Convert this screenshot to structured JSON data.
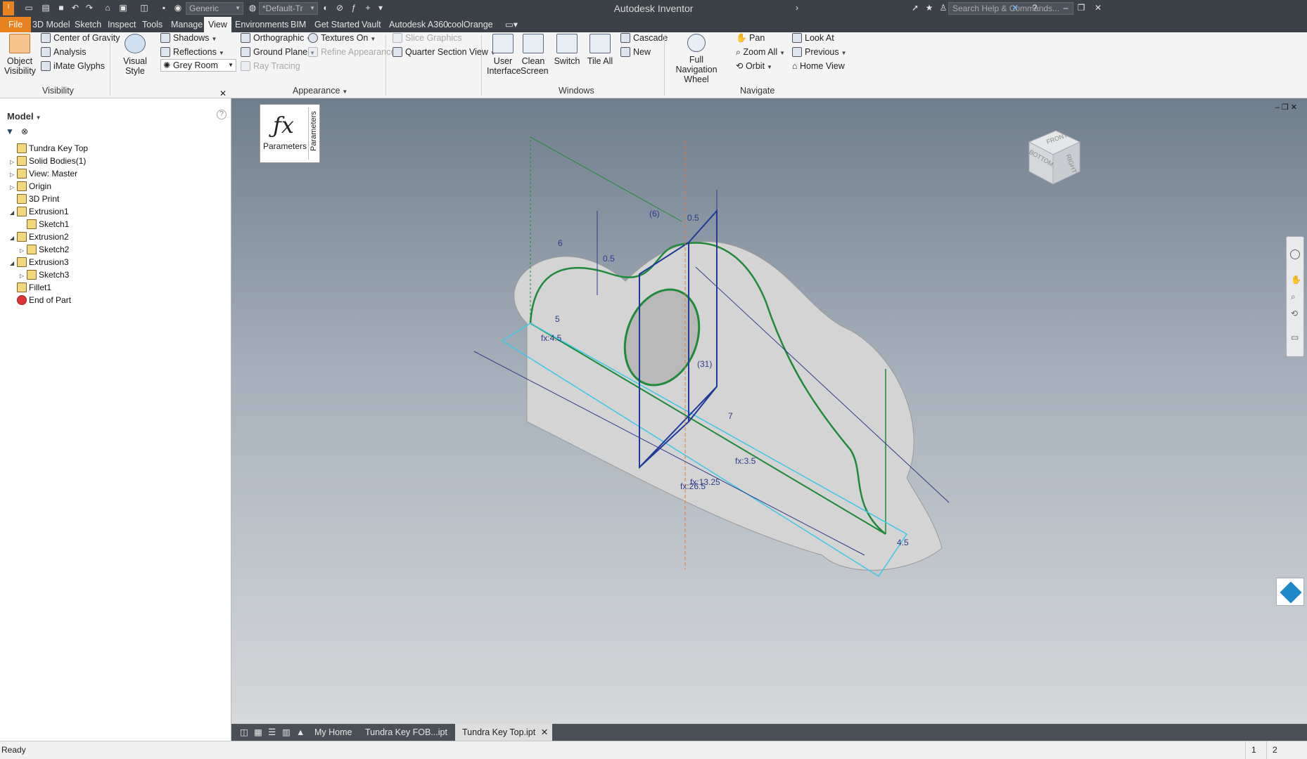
{
  "app": {
    "title": "Autodesk Inventor"
  },
  "quick_access": {
    "material": "Generic",
    "appearance": "*Default-Tr",
    "search_placeholder": "Search Help & Commands..."
  },
  "ribbon_tabs": [
    "File",
    "3D Model",
    "Sketch",
    "Inspect",
    "Tools",
    "Manage",
    "View",
    "Environments",
    "BIM",
    "Get Started",
    "Vault",
    "Autodesk A360",
    "coolOrange"
  ],
  "active_tab": "View",
  "ribbon": {
    "visibility": {
      "object_visibility": "Object Visibility",
      "center_of_gravity": "Center of Gravity",
      "analysis": "Analysis",
      "imate_glyphs": "iMate Glyphs",
      "group_label": "Visibility"
    },
    "appearance": {
      "visual_style": "Visual Style",
      "shadows": "Shadows",
      "reflections": "Reflections",
      "lighting_style": "Grey Room",
      "orthographic": "Orthographic",
      "ground_plane": "Ground Plane",
      "ray_tracing": "Ray Tracing",
      "textures_on": "Textures On",
      "refine_appearance": "Refine Appearance",
      "slice_graphics": "Slice Graphics",
      "quarter_section_view": "Quarter Section View",
      "group_label": "Appearance"
    },
    "windows": {
      "user_interface": "User Interface",
      "clean_screen": "Clean Screen",
      "switch": "Switch",
      "tile_all": "Tile All",
      "cascade": "Cascade",
      "new": "New",
      "group_label": "Windows"
    },
    "navigate": {
      "full_navigation_wheel": "Full Navigation Wheel",
      "pan": "Pan",
      "zoom_all": "Zoom All",
      "orbit": "Orbit",
      "look_at": "Look At",
      "previous": "Previous",
      "home_view": "Home View",
      "group_label": "Navigate"
    }
  },
  "browser": {
    "title": "Model",
    "tree": [
      {
        "label": "Tundra Key Top",
        "expander": ""
      },
      {
        "label": "Solid Bodies(1)",
        "expander": "▷"
      },
      {
        "label": "View: Master",
        "expander": "▷"
      },
      {
        "label": "Origin",
        "expander": "▷"
      },
      {
        "label": "3D Print",
        "expander": ""
      },
      {
        "label": "Extrusion1",
        "expander": "◢"
      },
      {
        "label": "Sketch1",
        "expander": ""
      },
      {
        "label": "Extrusion2",
        "expander": "◢"
      },
      {
        "label": "Sketch2",
        "expander": "▷"
      },
      {
        "label": "Extrusion3",
        "expander": "◢"
      },
      {
        "label": "Sketch3",
        "expander": "▷"
      },
      {
        "label": "Fillet1",
        "expander": ""
      },
      {
        "label": "End of Part",
        "expander": ""
      }
    ]
  },
  "viewport": {
    "parameters_panel": {
      "label": "Parameters",
      "side_label": "Parameters"
    },
    "viewcube": {
      "front": "FRONT",
      "right": "RIGHT",
      "bottom": "BOTTOM"
    },
    "dimensions": [
      "(6)",
      "0.5",
      "6",
      "0.5",
      "5",
      "fx:4.5",
      "(31)",
      "7",
      "fx:3.5",
      "fx:13.25",
      "fx:26.5",
      "4.5"
    ]
  },
  "doc_tabs": [
    "My Home",
    "Tundra Key FOB...ipt",
    "Tundra Key Top.ipt"
  ],
  "active_doc": "Tundra Key Top.ipt",
  "status": {
    "text": "Ready",
    "count1": "1",
    "count2": "2"
  },
  "colors": {
    "accent_file": "#e8821e",
    "titlebar": "#3c4147",
    "sketch_green": "#1e8a3a",
    "dimension_blue": "#2f3b8a",
    "viewport_top": "#6f7e8e"
  }
}
